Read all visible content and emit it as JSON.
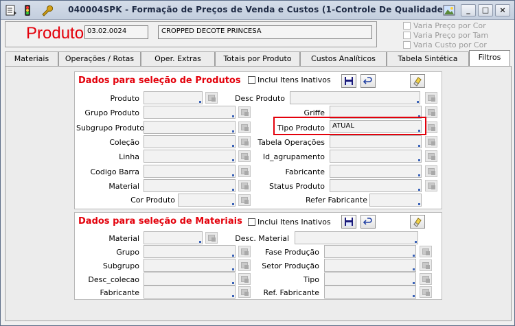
{
  "window": {
    "title": "040004SPK - Formação de Preços de Venda e Custos (1-Controle De Qualidade)",
    "buttons": {
      "minimize": "_",
      "maximize": "□",
      "close": "×"
    }
  },
  "header": {
    "produto_label": "Produto",
    "codigo": "03.02.0024",
    "descricao": "CROPPED DECOTE PRINCESA",
    "options": [
      "Varia Preço por Cor",
      "Varia Preço por Tam",
      "Varia Custo por Cor"
    ]
  },
  "tabs": [
    "Materiais",
    "Operações / Rotas",
    "Oper. Extras",
    "Totais por Produto",
    "Custos Analíticos",
    "Tabela Sintética",
    "Filtros"
  ],
  "produtos": {
    "title": "Dados para seleção de Produtos",
    "inativos_label": "Inclui Itens Inativos",
    "left": [
      "Produto",
      "Grupo Produto",
      "Subgrupo Produto",
      "Coleção",
      "Linha",
      "Codigo Barra",
      "Material",
      "Cor Produto"
    ],
    "right": [
      "Desc Produto",
      "Griffe",
      "Tipo Produto",
      "Tabela Operações",
      "Id_agrupamento",
      "Fabricante",
      "Status Produto",
      "Refer Fabricante"
    ],
    "tipo_produto_value": "ATUAL"
  },
  "materiais": {
    "title": "Dados para seleção de Materiais",
    "inativos_label": "Inclui Itens Inativos",
    "left": [
      "Material",
      "Grupo",
      "Subgrupo",
      "Desc_colecao",
      "Fabricante"
    ],
    "right": [
      "Desc. Material",
      "Fase Produção",
      "Setor Produção",
      "Tipo",
      "Ref. Fabricante"
    ]
  },
  "colors": {
    "accent": "#e3000b",
    "title_text": "#1e2a44"
  },
  "icons": [
    "document-menu-icon",
    "traffic-light-icon",
    "wrench-icon",
    "image-icon",
    "save-icon",
    "undo-icon",
    "eraser-icon",
    "lookup-icon"
  ]
}
